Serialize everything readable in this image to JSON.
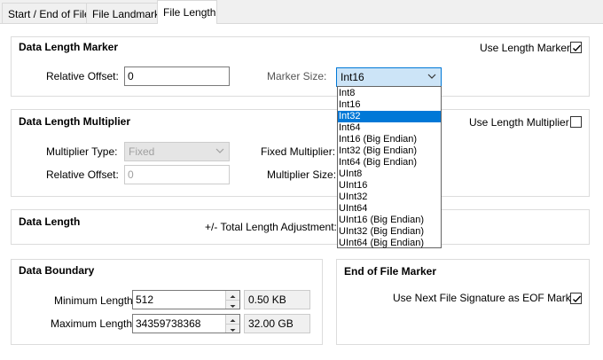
{
  "tabs": [
    {
      "label": "Start / End of File"
    },
    {
      "label": "File Landmarks"
    },
    {
      "label": "File Length"
    }
  ],
  "data_length_marker": {
    "title": "Data Length Marker",
    "use_label": "Use Length Marker",
    "use_checked": true,
    "relative_offset_label": "Relative Offset:",
    "relative_offset_value": "0",
    "marker_size_label": "Marker Size:",
    "marker_size_value": "Int16"
  },
  "marker_size_options": [
    "Int8",
    "Int16",
    "Int32",
    "Int64",
    "Int16 (Big Endian)",
    "Int32 (Big Endian)",
    "Int64 (Big Endian)",
    "UInt8",
    "UInt16",
    "UInt32",
    "UInt64",
    "UInt16 (Big Endian)",
    "UInt32 (Big Endian)",
    "UInt64 (Big Endian)"
  ],
  "marker_size_highlighted": "Int32",
  "data_length_multiplier": {
    "title": "Data Length Multiplier",
    "use_label": "Use Length Multiplier",
    "use_checked": false,
    "multiplier_type_label": "Multiplier Type:",
    "multiplier_type_value": "Fixed",
    "relative_offset_label": "Relative Offset:",
    "relative_offset_value": "0",
    "fixed_multiplier_label": "Fixed Multiplier:",
    "multiplier_size_label": "Multiplier Size:"
  },
  "data_length": {
    "title": "Data Length",
    "adjustment_label": "+/- Total Length Adjustment:"
  },
  "data_boundary": {
    "title": "Data Boundary",
    "min_label": "Minimum Length:",
    "min_value": "512",
    "min_display": "0.50 KB",
    "max_label": "Maximum Length:",
    "max_value": "34359738368",
    "max_display": "32.00 GB"
  },
  "eof_marker": {
    "title": "End of File Marker",
    "use_label": "Use Next File Signature as EOF Marker",
    "use_checked": true
  },
  "colors": {
    "selection": "#0078d7",
    "combo_open_bg": "#cce4f7"
  }
}
